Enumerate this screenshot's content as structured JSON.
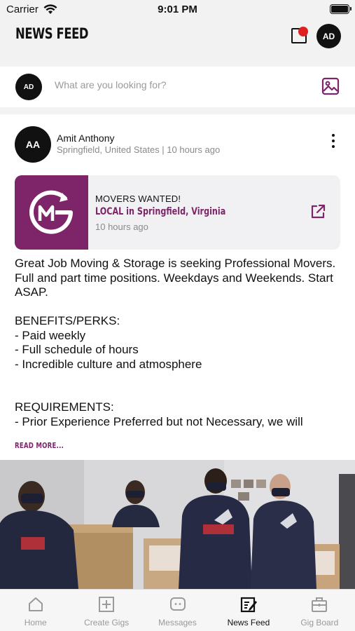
{
  "status_bar": {
    "carrier": "Carrier",
    "time": "9:01 PM"
  },
  "header": {
    "title": "NEWS FEED",
    "user_initials": "AD",
    "has_notification": true
  },
  "search": {
    "user_initials": "AD",
    "placeholder": "What are you looking for?"
  },
  "post": {
    "author_initials": "AA",
    "author_name": "Amit Anthony",
    "author_meta": "Springfield, United States | 10 hours ago",
    "gig": {
      "title": "MOVERS WANTED!",
      "location": "LOCAL in Springfield, Virginia",
      "time": "10 hours ago"
    },
    "body": "Great Job Moving & Storage is seeking Professional Movers. Full and part time positions. Weekdays and Weekends. Start ASAP.\n\nBENEFITS/PERKS:\n- Paid weekly\n- Full schedule of hours\n- Incredible culture and atmosphere\n\n\nREQUIREMENTS:\n- Prior Experience Preferred but not Necessary, we will",
    "read_more": "READ MORE..."
  },
  "tabs": [
    {
      "label": "Home",
      "icon": "home-icon",
      "active": false
    },
    {
      "label": "Create Gigs",
      "icon": "plus-square-icon",
      "active": false
    },
    {
      "label": "Messages",
      "icon": "chat-icon",
      "active": false
    },
    {
      "label": "News Feed",
      "icon": "edit-note-icon",
      "active": true
    },
    {
      "label": "Gig Board",
      "icon": "briefcase-icon",
      "active": false
    }
  ],
  "colors": {
    "accent": "#7e2468",
    "avatar": "#111111",
    "notification": "#e02020"
  }
}
